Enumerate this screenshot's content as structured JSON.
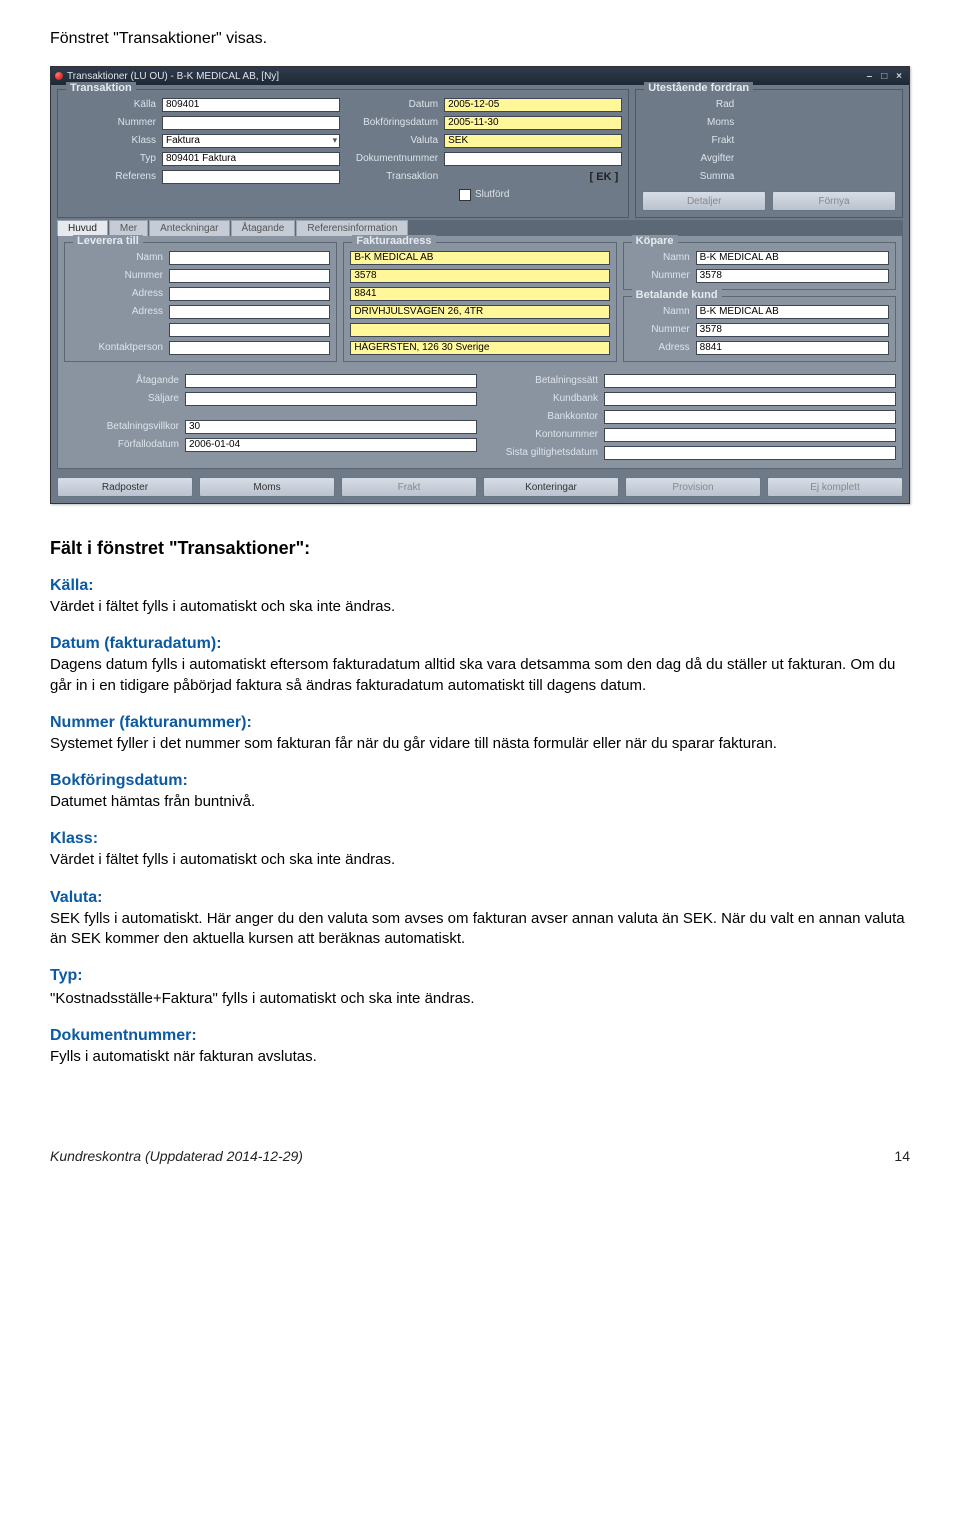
{
  "intro": "Fönstret \"Transaktioner\" visas.",
  "window": {
    "title": "Transaktioner (LU OU) - B-K MEDICAL AB, [Ny]",
    "groups": {
      "transaktion": {
        "title": "Transaktion",
        "kalla_lbl": "Källa",
        "kalla": "809401",
        "nummer_lbl": "Nummer",
        "nummer": "",
        "klass_lbl": "Klass",
        "klass": "Faktura",
        "typ_lbl": "Typ",
        "typ": "809401 Faktura",
        "referens_lbl": "Referens",
        "referens": "",
        "datum_lbl": "Datum",
        "datum": "2005-12-05",
        "bokf_lbl": "Bokföringsdatum",
        "bokf": "2005-11-30",
        "valuta_lbl": "Valuta",
        "valuta": "SEK",
        "doknr_lbl": "Dokumentnummer",
        "doknr": "",
        "trans_lbl": "Transaktion",
        "trans_ek": "[ EK ]",
        "slutford": "Slutförd"
      },
      "utest": {
        "title": "Utestående fordran",
        "rad": "Rad",
        "moms": "Moms",
        "frakt": "Frakt",
        "avgifter": "Avgifter",
        "summa": "Summa",
        "detaljer": "Detaljer",
        "fornya": "Förnya"
      }
    },
    "tabs": [
      "Huvud",
      "Mer",
      "Anteckningar",
      "Åtagande",
      "Referensinformation"
    ],
    "lower": {
      "leverera": {
        "title": "Leverera till",
        "namn_lbl": "Namn",
        "namn": "",
        "nummer_lbl": "Nummer",
        "nummer": "",
        "adress_lbl": "Adress",
        "adress": "",
        "adress2_lbl": "Adress",
        "adress2": "",
        "blank": "",
        "kontakt_lbl": "Kontaktperson",
        "kontakt": ""
      },
      "faktura": {
        "title": "Fakturaadress",
        "v1": "B-K MEDICAL AB",
        "v2": "3578",
        "v3": "8841",
        "v4": "DRIVHJULSVÄGEN 26, 4TR",
        "v5": "",
        "v6": "HÄGERSTEN, 126 30 Sverige"
      },
      "kopare": {
        "title": "Köpare",
        "namn_lbl": "Namn",
        "namn": "B-K MEDICAL AB",
        "nummer_lbl": "Nummer",
        "nummer": "3578"
      },
      "betalande": {
        "title": "Betalande kund",
        "namn_lbl": "Namn",
        "namn": "B-K MEDICAL AB",
        "nummer_lbl": "Nummer",
        "nummer": "3578",
        "adress_lbl": "Adress",
        "adress": "8841"
      },
      "extra_left": {
        "atagande_lbl": "Åtagande",
        "atagande": "",
        "saljare_lbl": "Säljare",
        "saljare": "",
        "villkor_lbl": "Betalningsvillkor",
        "villkor": "30",
        "forfall_lbl": "Förfallodatum",
        "forfall": "2006-01-04"
      },
      "extra_right": {
        "betsatt_lbl": "Betalningssätt",
        "kundbank_lbl": "Kundbank",
        "bankkontor_lbl": "Bankkontor",
        "konto_lbl": "Kontonummer",
        "sista_lbl": "Sista giltighetsdatum"
      }
    },
    "bottom_buttons": [
      "Radposter",
      "Moms",
      "Frakt",
      "Konteringar",
      "Provision",
      "Ej komplett"
    ]
  },
  "doc": {
    "heading": "Fält i fönstret \"Transaktioner\":",
    "kalla_h": "Källa:",
    "kalla_b": "Värdet i fältet fylls i automatiskt och ska inte ändras.",
    "datum_h": "Datum (fakturadatum):",
    "datum_b": "Dagens datum fylls i automatiskt eftersom fakturadatum alltid ska vara detsamma som den dag då du ställer ut fakturan. Om du går in i en tidigare påbörjad faktura så ändras fakturadatum automatiskt till dagens datum.",
    "nummer_h": "Nummer (fakturanummer):",
    "nummer_b": "Systemet fyller i det nummer som fakturan får när du går vidare till nästa formulär eller när du sparar fakturan.",
    "bokf_h": "Bokföringsdatum:",
    "bokf_b": "Datumet hämtas från buntnivå.",
    "klass_h": "Klass:",
    "klass_b": "Värdet i fältet fylls i automatiskt och ska inte ändras.",
    "valuta_h": "Valuta:",
    "valuta_b": "SEK fylls i automatiskt. Här anger du den valuta som avses om fakturan avser annan valuta än SEK. När du valt en annan valuta än SEK kommer den aktuella kursen att beräknas automatiskt.",
    "typ_h": "Typ:",
    "typ_b": "\"Kostnadsställe+Faktura\" fylls i automatiskt och ska inte ändras.",
    "dok_h": "Dokumentnummer:",
    "dok_b": "Fylls i automatiskt när fakturan avslutas."
  },
  "footer": {
    "left": "Kundreskontra (Uppdaterad 2014-12-29)",
    "page": "14"
  }
}
